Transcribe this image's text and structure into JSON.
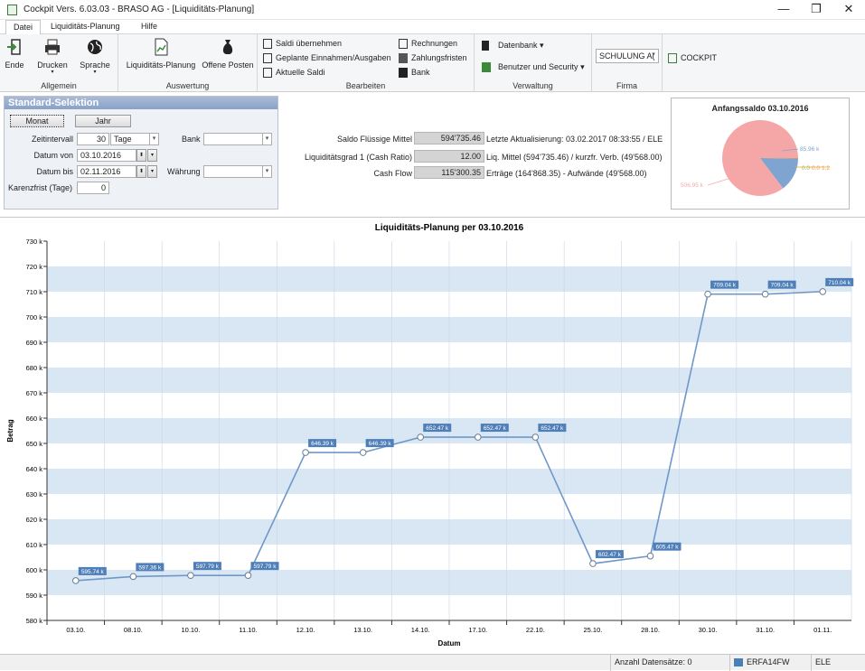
{
  "window": {
    "title": "Cockpit  Vers. 6.03.03  -  BRASO AG - [Liquiditäts-Planung]",
    "minimize": "—",
    "restore": "❐",
    "close": "✕"
  },
  "menu": [
    "Datei",
    "Liquiditäts-Planung",
    "Hilfe"
  ],
  "ribbon": {
    "allgemein": {
      "label": "Allgemein",
      "buttons": [
        "Ende",
        "Drucken",
        "Sprache"
      ]
    },
    "auswertung": {
      "label": "Auswertung",
      "buttons": [
        "Liquiditäts-Planung",
        "Offene Posten"
      ]
    },
    "bearbeiten": {
      "label": "Bearbeiten",
      "col1": [
        "Saldi übernehmen",
        "Geplante Einnahmen/Ausgaben",
        "Aktuelle Saldi"
      ],
      "col2": [
        "Rechnungen",
        "Zahlungsfristen",
        "Bank"
      ]
    },
    "verwaltung": {
      "label": "Verwaltung",
      "buttons": [
        "Datenbank",
        "Benutzer und Security"
      ]
    },
    "firma": {
      "label": "Firma",
      "value": "SCHULUNG A("
    },
    "cockpit": "COCKPIT"
  },
  "selection": {
    "title": "Standard-Selektion",
    "monat": "Monat",
    "jahr": "Jahr",
    "zeitintervall_label": "Zeitintervall",
    "zeitintervall_value": "30",
    "zeitintervall_unit": "Tage",
    "bank_label": "Bank",
    "bank_value": "",
    "datum_von_label": "Datum von",
    "datum_von_value": "03.10.2016",
    "datum_bis_label": "Datum bis",
    "datum_bis_value": "02.11.2016",
    "waehrung_label": "Währung",
    "waehrung_value": "",
    "karenzfrist_label": "Karenzfrist (Tage)",
    "karenzfrist_value": "0"
  },
  "kpis": [
    {
      "label": "Saldo Flüssige Mittel",
      "value": "594'735.46",
      "note": "Letzte Aktualisierung: 03.02.2017 08:33:55 / ELE"
    },
    {
      "label": "Liquiditätsgrad 1 (Cash Ratio)",
      "value": "12.00",
      "note": "Liq. Mittel (594'735.46) / kurzfr. Verb. (49'568.00)"
    },
    {
      "label": "Cash Flow",
      "value": "115'300.35",
      "note": "Erträge (164'868.35) - Aufwände (49'568.00)"
    }
  ],
  "pie": {
    "title": "Anfangssaldo 03.10.2016",
    "labels": [
      "506.95 k",
      "85.96 k",
      "0.0",
      "0.0",
      "1.2"
    ],
    "values": [
      506.95,
      85.96,
      0.0,
      0.0,
      1.2
    ],
    "colors": [
      "#f5a7a7",
      "#7ea4cf",
      "#8bc34a",
      "#e6a33e",
      "#e6a33e"
    ]
  },
  "chart_data": {
    "type": "line",
    "title": "Liquiditäts-Planung per 03.10.2016",
    "xlabel": "Datum",
    "ylabel": "Betrag",
    "x": [
      "03.10.",
      "08.10.",
      "10.10.",
      "11.10.",
      "12.10.",
      "13.10.",
      "14.10.",
      "17.10.",
      "22.10.",
      "25.10.",
      "28.10.",
      "30.10.",
      "31.10.",
      "01.11."
    ],
    "values": [
      595.74,
      597.36,
      597.79,
      597.79,
      646.39,
      646.39,
      652.47,
      652.47,
      652.47,
      602.47,
      605.47,
      709.04,
      709.04,
      710.04
    ],
    "value_labels": [
      "595.74 k",
      "597.36 k",
      "597.79 k",
      "597.79 k",
      "646.39 k",
      "646.39 k",
      "652.47 k",
      "652.47 k",
      "652.47 k",
      "602.47 k",
      "605.47 k",
      "709.04 k",
      "709.04 k",
      "710.04 k"
    ],
    "ylim": [
      580,
      730
    ],
    "yticks": [
      "580 k",
      "590 k",
      "600 k",
      "610 k",
      "620 k",
      "630 k",
      "640 k",
      "650 k",
      "660 k",
      "670 k",
      "680 k",
      "690 k",
      "700 k",
      "710 k",
      "720 k",
      "730 k"
    ],
    "line_color": "#6f98c9",
    "band_color": "#d9e7f4",
    "label_bg": "#4f7fb8",
    "grid": true
  },
  "status": {
    "count": "Anzahl Datensätze: 0",
    "host": "ERFA14FW",
    "user": "ELE"
  }
}
